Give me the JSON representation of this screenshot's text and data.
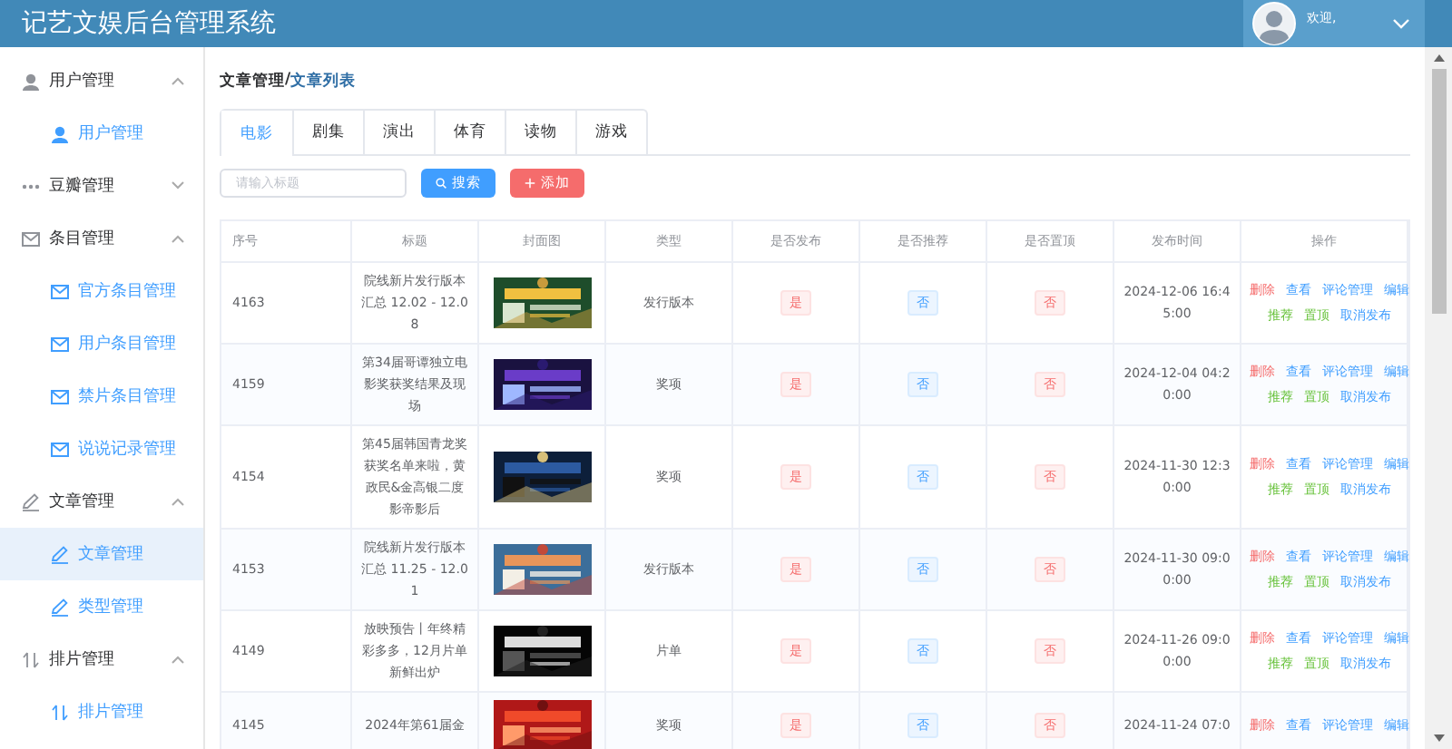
{
  "header": {
    "title": "记艺文娱后台管理系统",
    "user": {
      "greeting": "欢迎,"
    }
  },
  "sidebar": {
    "groups": [
      {
        "label": "用户管理",
        "expanded": true,
        "items": [
          {
            "label": "用户管理",
            "selected": false
          }
        ]
      },
      {
        "label": "豆瓣管理",
        "expanded": false
      },
      {
        "label": "条目管理",
        "expanded": true,
        "items": [
          {
            "label": "官方条目管理",
            "selected": false
          },
          {
            "label": "用户条目管理",
            "selected": false
          },
          {
            "label": "禁片条目管理",
            "selected": false
          },
          {
            "label": "说说记录管理",
            "selected": false
          }
        ]
      },
      {
        "label": "文章管理",
        "expanded": true,
        "items": [
          {
            "label": "文章管理",
            "selected": true
          },
          {
            "label": "类型管理",
            "selected": false
          }
        ]
      },
      {
        "label": "排片管理",
        "expanded": true,
        "items": [
          {
            "label": "排片管理",
            "selected": false
          }
        ]
      }
    ]
  },
  "breadcrumb": {
    "path": "文章管理",
    "separator": "/",
    "current": "文章列表"
  },
  "tabs": [
    {
      "label": "电影",
      "selected": true
    },
    {
      "label": "剧集",
      "selected": false
    },
    {
      "label": "演出",
      "selected": false
    },
    {
      "label": "体育",
      "selected": false
    },
    {
      "label": "读物",
      "selected": false
    },
    {
      "label": "游戏",
      "selected": false
    }
  ],
  "search": {
    "placeholder": "请输入标题",
    "buttons": [
      {
        "label": "搜索",
        "kind": "search"
      },
      {
        "label": "添加",
        "kind": "add"
      }
    ]
  },
  "table": {
    "columns": [
      "序号",
      "标题",
      "封面图",
      "类型",
      "是否发布",
      "是否推荐",
      "是否置顶",
      "发布时间",
      "操作"
    ],
    "rows": [
      {
        "id": "4163",
        "title": "院线新片发行版本汇总 12.02 - 12.08",
        "type": "发行版本",
        "published": "是",
        "recommended": "否",
        "pinned": "否",
        "time": "2024-12-06 16:45:00",
        "action_lines": [
          [
            {
              "text": "删除",
              "kind": "danger"
            },
            {
              "text": "查看",
              "kind": "primary"
            },
            {
              "text": "评论管理",
              "kind": "primary"
            },
            {
              "text": "编辑",
              "kind": "primary"
            }
          ],
          [
            {
              "text": "推荐",
              "kind": "success"
            },
            {
              "text": "置顶",
              "kind": "success"
            },
            {
              "text": "取消发布",
              "kind": "primary"
            }
          ]
        ]
      },
      {
        "id": "4159",
        "title": "第34届哥谭独立电影奖获奖结果及现场",
        "type": "奖项",
        "published": "是",
        "recommended": "否",
        "pinned": "否",
        "time": "2024-12-04 04:20:00",
        "action_lines": [
          [
            {
              "text": "删除",
              "kind": "danger"
            },
            {
              "text": "查看",
              "kind": "primary"
            },
            {
              "text": "评论管理",
              "kind": "primary"
            },
            {
              "text": "编辑",
              "kind": "primary"
            }
          ],
          [
            {
              "text": "推荐",
              "kind": "success"
            },
            {
              "text": "置顶",
              "kind": "success"
            },
            {
              "text": "取消发布",
              "kind": "primary"
            }
          ]
        ]
      },
      {
        "id": "4154",
        "title": "第45届韩国青龙奖获奖名单来啦，黄政民&金高银二度影帝影后",
        "type": "奖项",
        "published": "是",
        "recommended": "否",
        "pinned": "否",
        "time": "2024-11-30 12:30:00",
        "action_lines": [
          [
            {
              "text": "删除",
              "kind": "danger"
            },
            {
              "text": "查看",
              "kind": "primary"
            },
            {
              "text": "评论管理",
              "kind": "primary"
            },
            {
              "text": "编辑",
              "kind": "primary"
            }
          ],
          [
            {
              "text": "推荐",
              "kind": "success"
            },
            {
              "text": "置顶",
              "kind": "success"
            },
            {
              "text": "取消发布",
              "kind": "primary"
            }
          ]
        ]
      },
      {
        "id": "4153",
        "title": "院线新片发行版本汇总 11.25 - 12.01",
        "type": "发行版本",
        "published": "是",
        "recommended": "否",
        "pinned": "否",
        "time": "2024-11-30 09:00:00",
        "action_lines": [
          [
            {
              "text": "删除",
              "kind": "danger"
            },
            {
              "text": "查看",
              "kind": "primary"
            },
            {
              "text": "评论管理",
              "kind": "primary"
            },
            {
              "text": "编辑",
              "kind": "primary"
            }
          ],
          [
            {
              "text": "推荐",
              "kind": "success"
            },
            {
              "text": "置顶",
              "kind": "success"
            },
            {
              "text": "取消发布",
              "kind": "primary"
            }
          ]
        ]
      },
      {
        "id": "4149",
        "title": "放映预告丨年终精彩多多，12月片单新鲜出炉",
        "type": "片单",
        "published": "是",
        "recommended": "否",
        "pinned": "否",
        "time": "2024-11-26 09:00:00",
        "action_lines": [
          [
            {
              "text": "删除",
              "kind": "danger"
            },
            {
              "text": "查看",
              "kind": "primary"
            },
            {
              "text": "评论管理",
              "kind": "primary"
            },
            {
              "text": "编辑",
              "kind": "primary"
            }
          ],
          [
            {
              "text": "推荐",
              "kind": "success"
            },
            {
              "text": "置顶",
              "kind": "success"
            },
            {
              "text": "取消发布",
              "kind": "primary"
            }
          ]
        ]
      },
      {
        "id": "4145",
        "title": "2024年第61届金",
        "type": "奖项",
        "published": "是",
        "recommended": "否",
        "pinned": "否",
        "time": "2024-11-24 07:0",
        "action_lines": [
          [
            {
              "text": "删除",
              "kind": "danger"
            },
            {
              "text": "查看",
              "kind": "primary"
            },
            {
              "text": "评论管理",
              "kind": "primary"
            },
            {
              "text": "编辑",
              "kind": "primary"
            }
          ]
        ]
      }
    ]
  }
}
